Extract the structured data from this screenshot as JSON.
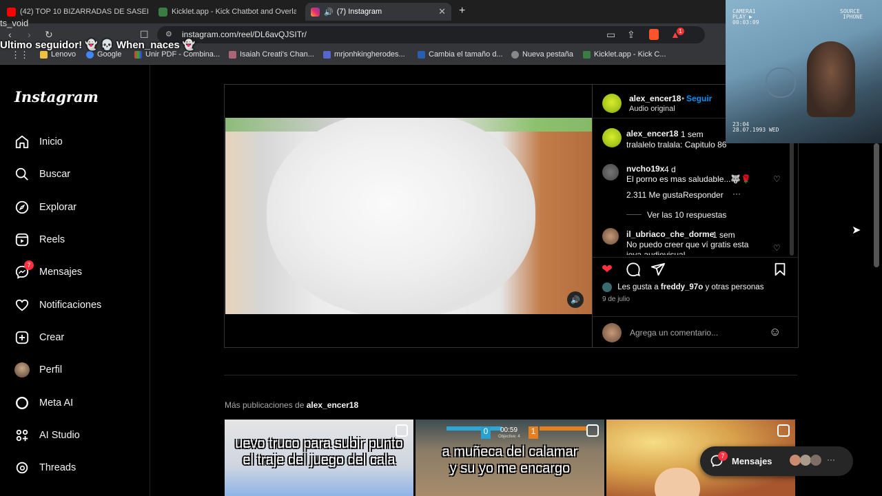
{
  "browser": {
    "tabs": [
      {
        "title": "(42) TOP 10 BIZARRADAS DE SASEL -",
        "favicon": "youtube-icon"
      },
      {
        "title": "Kicklet.app - Kick Chatbot and Overla",
        "favicon": "kicklet-icon"
      },
      {
        "title": "(7) Instagram",
        "favicon": "instagram-icon",
        "active": true
      }
    ],
    "url": "instagram.com/reel/DL6avQJSITr/",
    "bookmarks": [
      "Lenovo",
      "Google",
      "Unir PDF - Combina...",
      "Isaiah Creati's Chan...",
      "mrjonhkingherodes...",
      "Cambia el tamaño d...",
      "Nueva pestaña",
      "Kicklet.app - Kick C..."
    ],
    "notif_count": "1"
  },
  "overlay": {
    "line1": "Ultimo seguidor! 👻 💀 When_naces 👻",
    "line2": "ts_void"
  },
  "sidebar": {
    "logo": "Instagram",
    "items": [
      {
        "label": "Inicio",
        "icon": "home-icon"
      },
      {
        "label": "Buscar",
        "icon": "search-icon"
      },
      {
        "label": "Explorar",
        "icon": "compass-icon"
      },
      {
        "label": "Reels",
        "icon": "reels-icon"
      },
      {
        "label": "Mensajes",
        "icon": "messenger-icon",
        "badge": "7"
      },
      {
        "label": "Notificaciones",
        "icon": "heart-icon"
      },
      {
        "label": "Crear",
        "icon": "plus-square-icon"
      },
      {
        "label": "Perfil",
        "icon": "avatar-icon"
      },
      {
        "label": "Meta AI",
        "icon": "meta-ai-icon"
      },
      {
        "label": "AI Studio",
        "icon": "ai-studio-icon"
      },
      {
        "label": "Threads",
        "icon": "threads-icon"
      }
    ]
  },
  "post": {
    "author": "alex_encer18",
    "follow": "Seguir",
    "dot": "•",
    "audio": "Audio original",
    "caption": {
      "user": "alex_encer18",
      "time": "1 sem",
      "text": "tralalelo tralala: Capitulo 86"
    },
    "comments": [
      {
        "user": "nvcho19x",
        "time": "4 d",
        "text": "El porno es mas saludable...🐺🌹",
        "likes": "2.311 Me gusta",
        "reply": "Responder",
        "replies": "Ver las 10 respuestas"
      },
      {
        "user": "il_ubriaco_che_dorme",
        "time": "1 sem",
        "text": "No puedo creer que ví gratis esta",
        "text2": "joya audiovisual"
      }
    ],
    "likes_prefix": "Les gusta a",
    "likes_user": "freddy_97o",
    "likes_suffix": "y otras personas",
    "date": "9 de julio",
    "comment_placeholder": "Agrega un comentario...",
    "liked": true
  },
  "more": {
    "prefix": "Más publicaciones de",
    "user": "alex_encer18",
    "thumbs": [
      {
        "caption1": "uevo truco para subir punto",
        "caption2": "el traje del  juego del cala"
      },
      {
        "caption1": "a muñeca del calamar",
        "caption2": "y su yo me encargo",
        "timer": "00:59",
        "score": "0",
        "count": "1",
        "objective": "Objective: 4"
      },
      {
        "caption1": "",
        "caption2": ""
      }
    ]
  },
  "webcam": {
    "cam": "CAMERA1",
    "play": "PLAY ▶",
    "tc": "00:03:09",
    "source": "SOURCE",
    "device": "IPHONE",
    "time": "23:04",
    "date": "28.07.1993 WED"
  },
  "messages_pill": {
    "label": "Mensajes",
    "badge": "7",
    "more": "···"
  },
  "colors": {
    "like": "#ff3040",
    "follow": "#0095f6",
    "badge": "#ff3040"
  }
}
